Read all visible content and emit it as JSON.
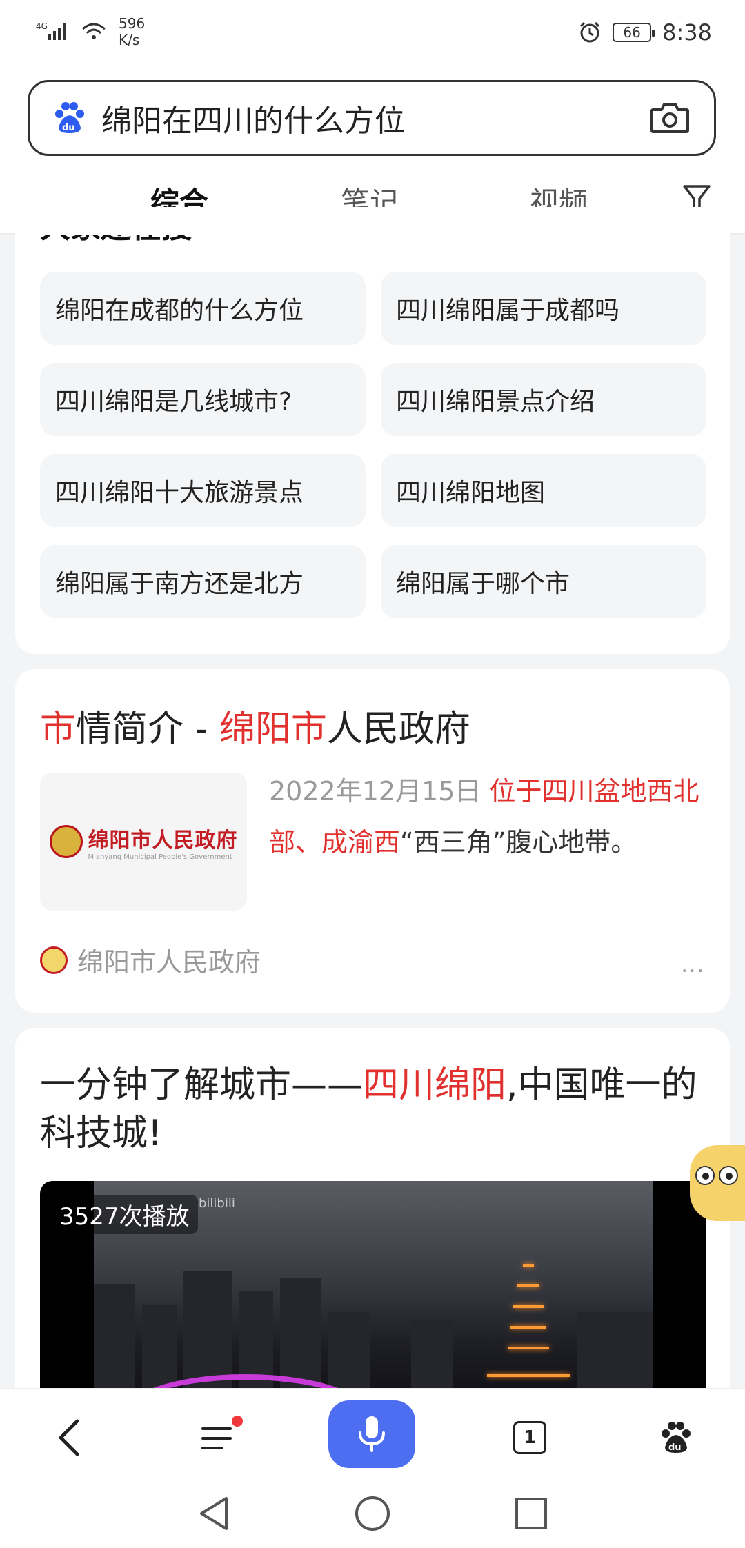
{
  "status_bar": {
    "signal": "4G",
    "net_speed_value": "596",
    "net_speed_unit": "K/s",
    "battery": "66",
    "time": "8:38"
  },
  "search": {
    "query": "绵阳在四川的什么方位",
    "logo_icon": "baidu-paw-icon",
    "camera_icon": "camera-icon"
  },
  "tabs": [
    {
      "label": "综合",
      "active": true
    },
    {
      "label": "笔记",
      "active": false
    },
    {
      "label": "视频",
      "active": false
    }
  ],
  "filter_icon": "filter-icon",
  "related": {
    "heading_partial": "大家还在搜",
    "items": [
      "绵阳在成都的什么方位",
      "四川绵阳属于成都吗",
      "四川绵阳是几线城市?",
      "四川绵阳景点介绍",
      "四川绵阳十大旅游景点",
      "四川绵阳地图",
      "绵阳属于南方还是北方",
      "绵阳属于哪个市"
    ]
  },
  "result1": {
    "title_parts": [
      {
        "text": "市",
        "highlight": true
      },
      {
        "text": "情简介 - ",
        "highlight": false
      },
      {
        "text": "绵阳市",
        "highlight": true
      },
      {
        "text": "人民政府",
        "highlight": false
      }
    ],
    "thumb_title": "绵阳市人民政府",
    "thumb_subtitle": "Mianyang Municipal People's Government",
    "date": "2022年12月15日",
    "snippet_highlight": "位于四川盆地西北部、成渝西",
    "snippet_rest": "“西三角”腹心地带。",
    "source": "绵阳市人民政府",
    "more": "..."
  },
  "result2": {
    "title_parts": [
      {
        "text": "一分钟了解城市——",
        "highlight": false
      },
      {
        "text": "四川绵阳",
        "highlight": true
      },
      {
        "text": ",中国唯一的科技城!",
        "highlight": false
      }
    ],
    "play_count": "3527次播放",
    "watermark": "bilibili"
  },
  "toolbar": {
    "back_icon": "back-arrow-icon",
    "menu_icon": "menu-icon",
    "mic_icon": "microphone-icon",
    "tab_count": "1",
    "home_icon": "baidu-paw-icon"
  },
  "colors": {
    "accent": "#4e6ef2",
    "highlight": "#e0312e"
  }
}
